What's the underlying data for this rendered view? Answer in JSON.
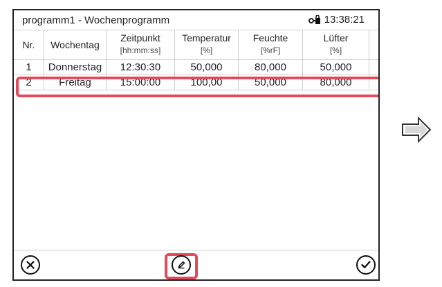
{
  "header": {
    "title": "programm1 - Wochenprogramm",
    "time": "13:38:21"
  },
  "columns": [
    {
      "label": "Nr.",
      "unit": ""
    },
    {
      "label": "Wochentag",
      "unit": ""
    },
    {
      "label": "Zeitpunkt",
      "unit": "[hh:mm:ss]"
    },
    {
      "label": "Temperatur",
      "unit": "[%]"
    },
    {
      "label": "Feuchte",
      "unit": "[%rF]"
    },
    {
      "label": "Lüfter",
      "unit": "[%]"
    }
  ],
  "rows": [
    {
      "nr": "1",
      "day": "Donnerstag",
      "time": "12:30:30",
      "temp": "50,000",
      "humidity": "80,000",
      "fan": "50,000"
    },
    {
      "nr": "2",
      "day": "Freitag",
      "time": "15:00:00",
      "temp": "100,00",
      "humidity": "50,000",
      "fan": "80,000"
    }
  ],
  "bottom_bar": {
    "cancel_icon": "close-circle-icon",
    "edit_icon": "edit-circle-icon",
    "confirm_icon": "check-circle-icon"
  },
  "colors": {
    "highlight": "#e44b5a"
  }
}
